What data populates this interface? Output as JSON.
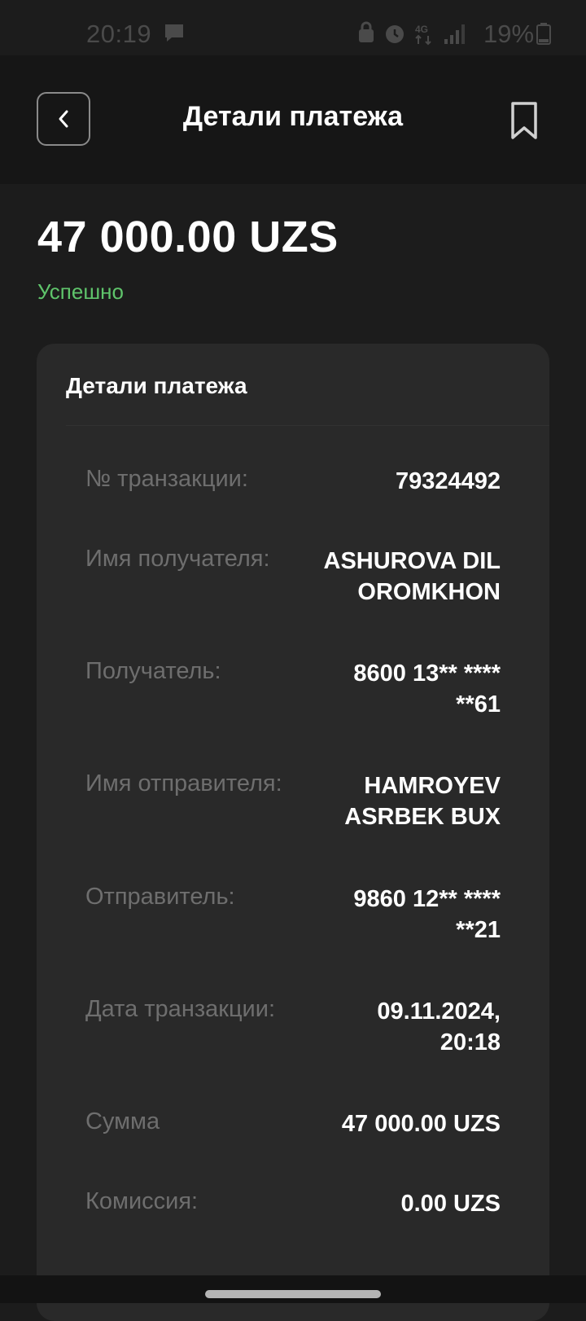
{
  "status_bar": {
    "time": "20:19",
    "battery": "19%",
    "icons": [
      "message-icon",
      "vpn-icon",
      "alarm-icon",
      "4g-icon",
      "signal-icon",
      "battery-icon"
    ]
  },
  "header": {
    "title": "Детали платежа",
    "back_icon": "chevron-left-icon",
    "bookmark_icon": "bookmark-icon"
  },
  "payment": {
    "amount": "47 000.00 UZS",
    "status": "Успешно",
    "status_color": "#5fc46b"
  },
  "details": {
    "title": "Детали платежа",
    "rows": [
      {
        "label": "№ транзакции:",
        "value": "79324492"
      },
      {
        "label": "Имя получателя:",
        "value": "ASHUROVA DIL OROMKHON"
      },
      {
        "label": "Получатель:",
        "value": "8600 13** **** **61"
      },
      {
        "label": "Имя отправителя:",
        "value": "HAMROYEV ASRBEK BUX"
      },
      {
        "label": "Отправитель:",
        "value": "9860 12** **** **21"
      },
      {
        "label": "Дата транзакции:",
        "value": "09.11.2024, 20:18"
      },
      {
        "label": "Сумма",
        "value": "47 000.00 UZS"
      },
      {
        "label": "Комиссия:",
        "value": "0.00 UZS"
      }
    ]
  }
}
